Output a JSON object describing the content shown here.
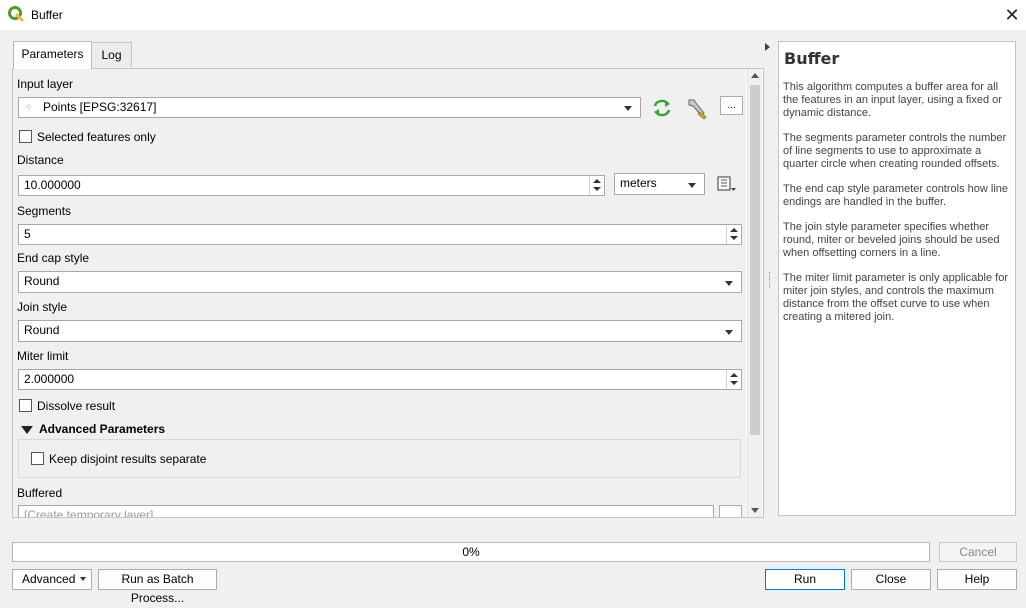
{
  "window": {
    "title": "Buffer",
    "close_glyph": "✕"
  },
  "tabs": [
    {
      "label": "Parameters"
    },
    {
      "label": "Log"
    }
  ],
  "params": {
    "input_layer": {
      "label": "Input layer",
      "value": "Points [EPSG:32617]",
      "more_btn": "..."
    },
    "selected_only": {
      "label": "Selected features only",
      "checked": false
    },
    "distance": {
      "label": "Distance",
      "value": "10.000000",
      "unit": "meters"
    },
    "segments": {
      "label": "Segments",
      "value": "5"
    },
    "end_cap": {
      "label": "End cap style",
      "value": "Round"
    },
    "join_style": {
      "label": "Join style",
      "value": "Round"
    },
    "miter_limit": {
      "label": "Miter limit",
      "value": "2.000000"
    },
    "dissolve": {
      "label": "Dissolve result",
      "checked": false
    },
    "advanced": {
      "label": "Advanced Parameters",
      "keep_disjoint": "Keep disjoint results separate"
    },
    "buffered": {
      "label": "Buffered",
      "placeholder": "[Create temporary layer]"
    }
  },
  "help": {
    "title": "Buffer",
    "paragraphs": [
      "This algorithm computes a buffer area for all the features in an input layer, using a fixed or dynamic distance.",
      "The segments parameter controls the number of line segments to use to approximate a quarter circle when creating rounded offsets.",
      "The end cap style parameter controls how line endings are handled in the buffer.",
      "The join style parameter specifies whether round, miter or beveled joins should be used when offsetting corners in a line.",
      "The miter limit parameter is only applicable for miter join styles, and controls the maximum distance from the offset curve to use when creating a mitered join."
    ]
  },
  "progress": {
    "text": "0%",
    "value": 0
  },
  "buttons": {
    "cancel": "Cancel",
    "advanced": "Advanced",
    "batch": "Run as Batch Process...",
    "run": "Run",
    "close": "Close",
    "help": "Help"
  },
  "colors": {
    "qgis_green": "#589632",
    "qgis_yellow": "#f0b73e",
    "accent_blue": "#0078d4"
  }
}
